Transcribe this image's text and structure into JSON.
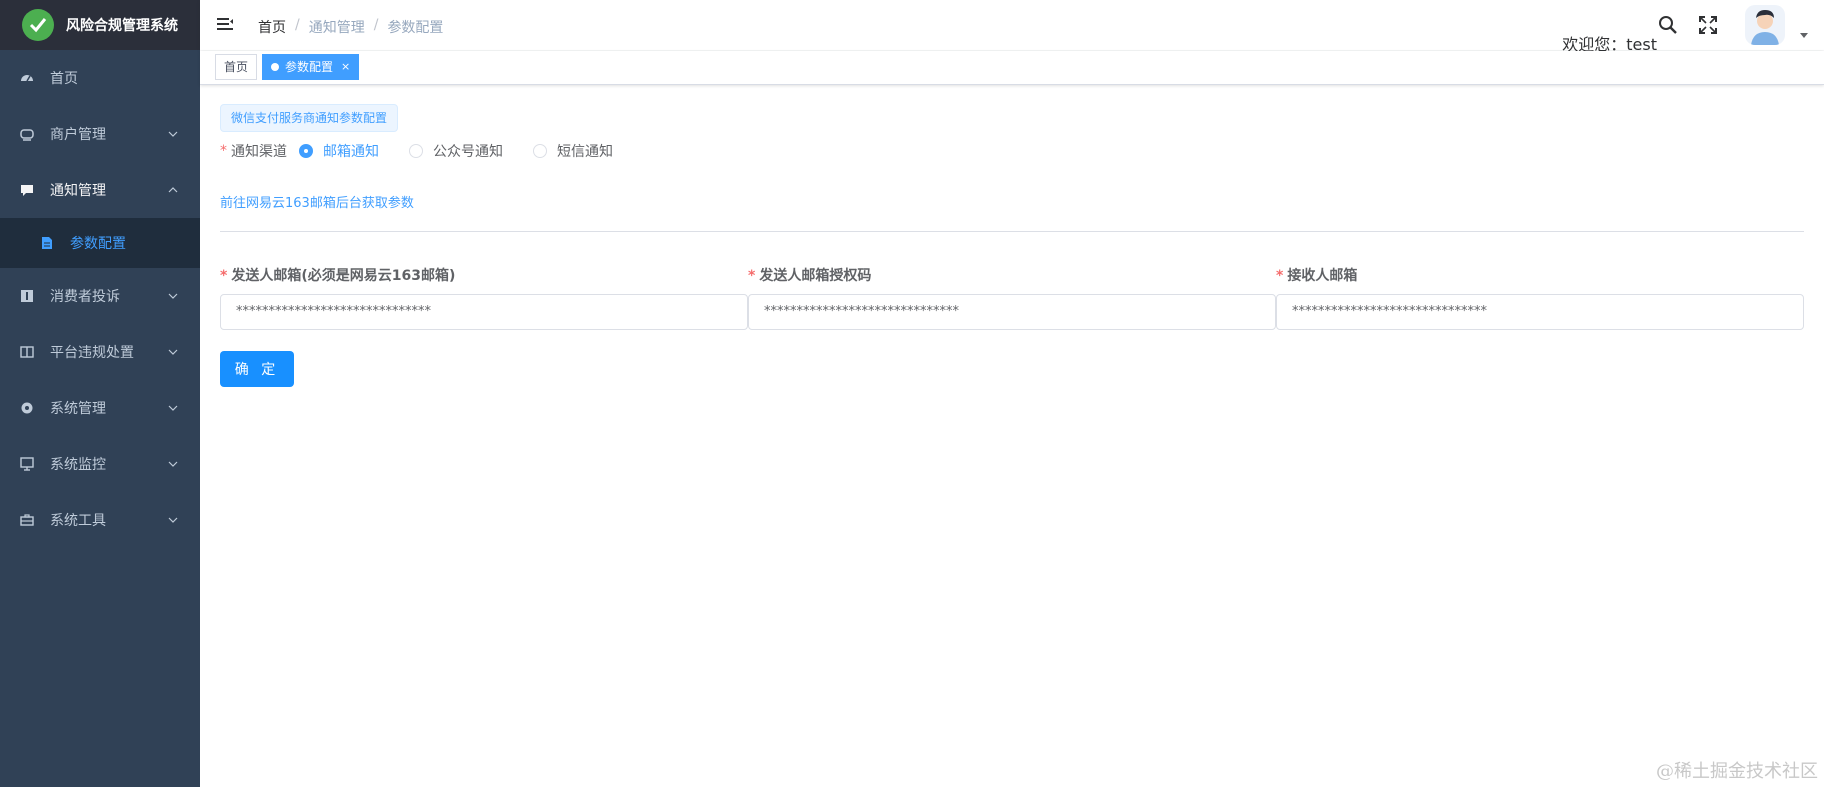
{
  "app": {
    "title": "风险合规管理系统"
  },
  "sidebar": {
    "items": [
      {
        "label": "首页"
      },
      {
        "label": "商户管理"
      },
      {
        "label": "通知管理"
      },
      {
        "label": "参数配置"
      },
      {
        "label": "消费者投诉"
      },
      {
        "label": "平台违规处置"
      },
      {
        "label": "系统管理"
      },
      {
        "label": "系统监控"
      },
      {
        "label": "系统工具"
      }
    ]
  },
  "navbar": {
    "breadcrumb": [
      "首页",
      "通知管理",
      "参数配置"
    ],
    "separator": "/",
    "welcome": "欢迎您：test"
  },
  "tags": [
    {
      "label": "首页"
    },
    {
      "label": "参数配置",
      "close": "×"
    }
  ],
  "main": {
    "section_tag": "微信支付服务商通知参数配置",
    "channel": {
      "required": "*",
      "label": "通知渠道",
      "options": [
        "邮箱通知",
        "公众号通知",
        "短信通知"
      ],
      "selected": "邮箱通知"
    },
    "link": "前往网易云163邮箱后台获取参数",
    "fields": [
      {
        "required": "*",
        "label": "发送人邮箱(必须是网易云163邮箱)",
        "value": "******************************"
      },
      {
        "required": "*",
        "label": "发送人邮箱授权码",
        "value": "******************************"
      },
      {
        "required": "*",
        "label": "接收人邮箱",
        "value": "******************************"
      }
    ],
    "confirm": "确 定"
  },
  "watermark": "@稀土掘金技术社区",
  "colors": {
    "sidebar_bg": "#304156",
    "logo_bg": "#2b2f3a",
    "active_sub_bg": "#1f2d3d",
    "accent": "#409eff",
    "button": "#1890ff",
    "required": "#f56c6c"
  }
}
